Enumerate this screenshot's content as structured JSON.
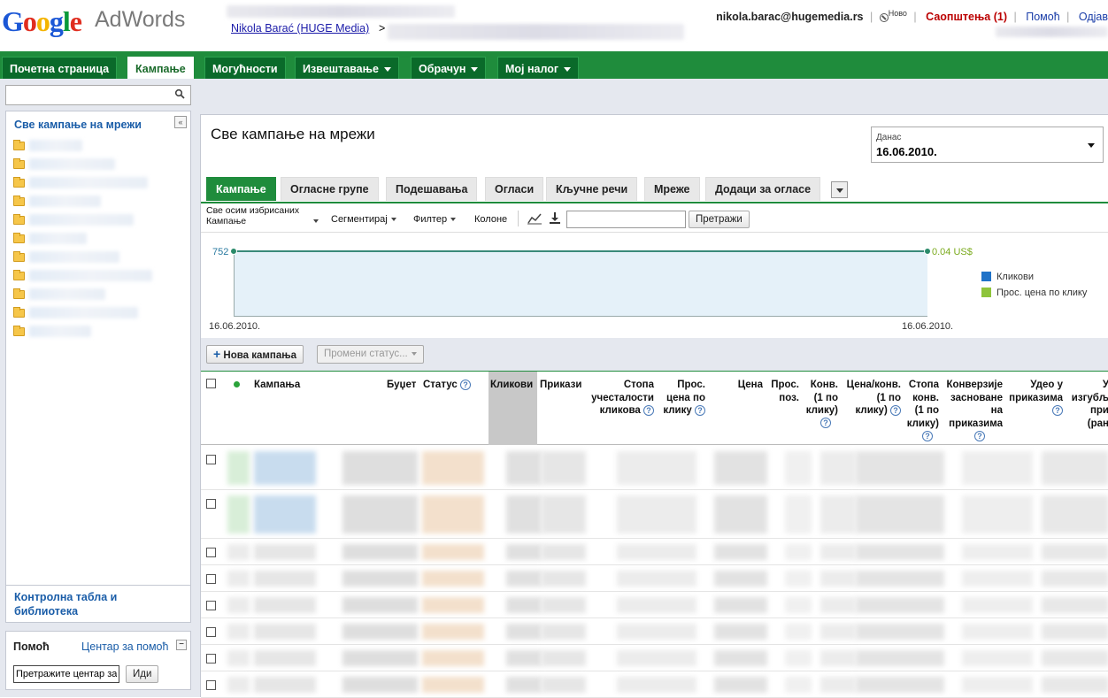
{
  "header": {
    "logo_parts": [
      "G",
      "o",
      "o",
      "g",
      "l",
      "e"
    ],
    "product": "AdWords",
    "account_link": "Nikola Barać (HUGE Media)",
    "account_sep": ">",
    "email": "nikola.barac@hugemedia.rs",
    "new_label": "Ново",
    "notifications": "Саопштења (1)",
    "help": "Помоћ",
    "signout": "Одјав"
  },
  "nav": {
    "tabs": [
      {
        "label": "Почетна страница"
      },
      {
        "label": "Кампање"
      },
      {
        "label": "Могућности"
      },
      {
        "label": "Извештавање"
      },
      {
        "label": "Обрачун"
      },
      {
        "label": "Мој налог"
      }
    ]
  },
  "sidebar": {
    "search_placeholder": "",
    "title": "Све кампање на мрежи",
    "collapse": "«",
    "bottom_link": "Контролна табла и библиотека",
    "help_title": "Помоћ",
    "help_center": "Центар за помоћ",
    "help_min": "−",
    "help_search_value": "Претражите центар за",
    "help_go": "Иди"
  },
  "main": {
    "title": "Све кампање на мрежи",
    "date_label": "Данас",
    "date_value": "16.06.2010.",
    "subtabs": [
      {
        "label": "Кампање"
      },
      {
        "label": "Огласне групе"
      },
      {
        "label": "Подешавања"
      },
      {
        "label": "Огласи"
      },
      {
        "label": "Кључне речи"
      },
      {
        "label": "Мреже"
      },
      {
        "label": "Додаци за огласе"
      }
    ],
    "toolbar": {
      "filter_view_line1": "Све осим избрисаних",
      "filter_view_line2": "Кампање",
      "segment": "Сегментирај",
      "filter": "Филтер",
      "columns": "Колоне",
      "search_button": "Претражи"
    },
    "chart": {
      "y_left_label": "752",
      "y_right_label": "0.04 US$",
      "x_start": "16.06.2010.",
      "x_end": "16.06.2010.",
      "legend": [
        {
          "name": "Кликови",
          "color": "#1f72c8"
        },
        {
          "name": "Прос. цена по клику",
          "color": "#8ec43b"
        }
      ]
    },
    "table_toolbar": {
      "new_campaign": "Нова кампања",
      "change_status": "Промени статус..."
    },
    "columns": {
      "campaign": "Кампања",
      "budget": "Буџет",
      "status": "Статус",
      "clicks": "Кликови",
      "impressions": "Прикази",
      "ctr": [
        "Стопа",
        "учесталости",
        "кликова"
      ],
      "avg_cpc": [
        "Прос.",
        "цена по",
        "клику"
      ],
      "cost": "Цена",
      "avg_pos": [
        "Прос.",
        "поз."
      ],
      "conv": [
        "Конв.",
        "(1 по",
        "клику)"
      ],
      "cost_conv": [
        "Цена/конв.",
        "(1 по",
        "клику)"
      ],
      "conv_rate": [
        "Стопа",
        "конв.",
        "(1 по",
        "клику)"
      ],
      "view_conv": [
        "Конверзије",
        "засноване",
        "на",
        "приказима"
      ],
      "impr_share": [
        "Удео у",
        "приказима"
      ],
      "lost_share": [
        "У",
        "изгубљ",
        "при",
        "(ран"
      ]
    }
  }
}
